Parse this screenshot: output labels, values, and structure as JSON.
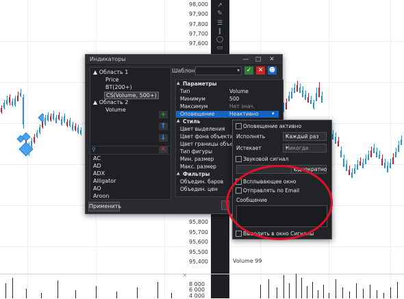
{
  "chart": {
    "price_ticks": [
      "98,000",
      "97,900",
      "97,800",
      "97,700",
      "97,600",
      "95,800",
      "95,700",
      "95,600",
      "95,500",
      "95,400"
    ],
    "volume_label": "Volume 99",
    "volume_ticks": [
      "8 000",
      "6 000",
      "4 000"
    ]
  },
  "dialog": {
    "title": "Индикаторы",
    "tree": {
      "area1": "Область 1",
      "price": "Price",
      "bt": "BT(200+)",
      "cs": "CS(Volume, 500+)",
      "area2": "Область 2",
      "volume": "Volume"
    },
    "indicator_list": [
      "AC",
      "AD",
      "ADX",
      "Alligator",
      "AO",
      "Aroon"
    ],
    "apply_label": "Применить",
    "template_label": "Шаблон",
    "properties": [
      {
        "key": "Параметры",
        "value": "",
        "group": true
      },
      {
        "key": "Тип",
        "value": "Volume"
      },
      {
        "key": "Минимум",
        "value": "500"
      },
      {
        "key": "Максимум",
        "value": "Нет знач."
      },
      {
        "key": "Оповещение",
        "value": "Неактивно",
        "selected": true
      },
      {
        "key": "Стиль",
        "value": "",
        "group": true
      },
      {
        "key": "Цвет выделения",
        "value": ""
      },
      {
        "key": "Цвет фона объекта",
        "value": ""
      },
      {
        "key": "Цвет границы объе...",
        "value": ""
      },
      {
        "key": "Тип фигуры",
        "value": ""
      },
      {
        "key": "Мин. размер",
        "value": ""
      },
      {
        "key": "Макс. размер",
        "value": ""
      },
      {
        "key": "Фильтры",
        "value": "",
        "group": true
      },
      {
        "key": "Объедин. баров",
        "value": ""
      },
      {
        "key": "Объедин. цен",
        "value": ""
      }
    ]
  },
  "alert_popup": {
    "alert_active": "Оповещение активно",
    "execute_label": "Исполнять",
    "execute_value": "Каждый раз",
    "expires_label": "Истекает",
    "expires_value": "Никогда",
    "sound_label": "Звуковой сигнал",
    "once_value": "Однократно",
    "popup_window": "Всплывающее окно",
    "send_email": "Отправлять по Email",
    "message_label": "Сообщение",
    "to_signals": "Выводить в окно Сигналы"
  },
  "colors": {
    "accent_blue": "#1565c0",
    "add_green": "#2e9e3e",
    "delete_red": "#d9302b",
    "highlight_circle": "#e0102a",
    "candle_up": "#2f8fd8",
    "candle_down": "#c8202c"
  }
}
